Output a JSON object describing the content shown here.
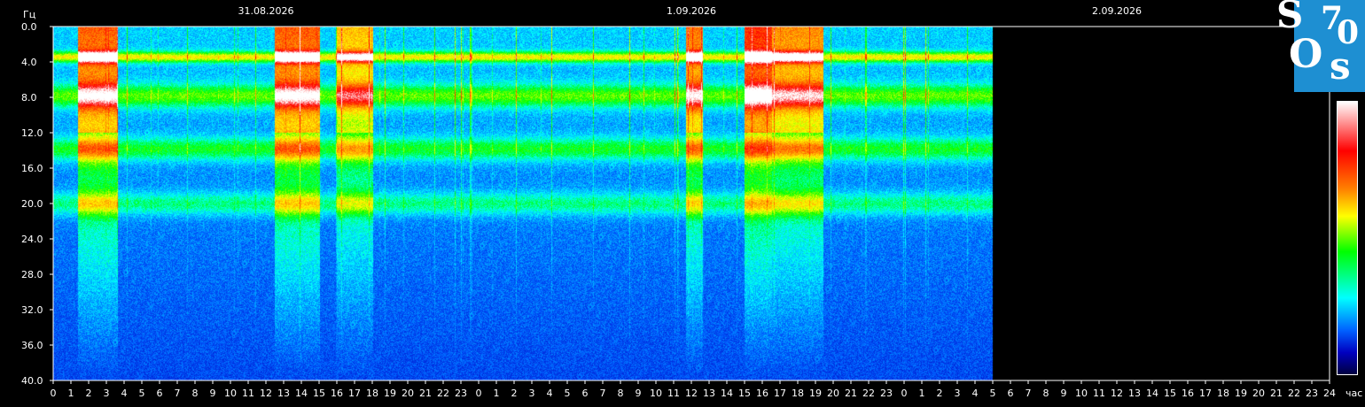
{
  "chart_data": {
    "type": "heatmap",
    "title": "",
    "ylabel": "Гц",
    "xlabel": "час",
    "ylim": [
      0,
      40
    ],
    "y_ticks": [
      "0.0",
      "4.0",
      "8.0",
      "12.0",
      "16.0",
      "20.0",
      "24.0",
      "28.0",
      "32.0",
      "36.0",
      "40.0"
    ],
    "x_ticks": [
      "0",
      "1",
      "2",
      "3",
      "4",
      "5",
      "6",
      "7",
      "8",
      "9",
      "10",
      "11",
      "12",
      "13",
      "14",
      "15",
      "16",
      "17",
      "18",
      "19",
      "20",
      "21",
      "22",
      "23",
      "0",
      "1",
      "2",
      "3",
      "4",
      "5",
      "6",
      "7",
      "8",
      "9",
      "10",
      "11",
      "12",
      "13",
      "14",
      "15",
      "16",
      "17",
      "18",
      "19",
      "20",
      "21",
      "22",
      "23",
      "0",
      "1",
      "2",
      "3",
      "4",
      "5",
      "6",
      "7",
      "8",
      "9",
      "10",
      "11",
      "12",
      "13",
      "14",
      "15",
      "16",
      "17",
      "18",
      "19",
      "20",
      "21",
      "22",
      "23",
      "24"
    ],
    "dates": [
      {
        "label": "31.08.2026",
        "hour": 12
      },
      {
        "label": "1.09.2026",
        "hour": 36
      },
      {
        "label": "2.09.2026",
        "hour": 60
      }
    ],
    "data_end_hour": 53,
    "x_range_hours": [
      0,
      72
    ],
    "resonance_bands_hz": [
      3.4,
      7.8,
      13.8,
      20.0
    ],
    "bursts": [
      {
        "start": 1.4,
        "end": 3.6,
        "level": 0.9
      },
      {
        "start": 12.5,
        "end": 15.0,
        "level": 0.9
      },
      {
        "start": 16.0,
        "end": 18.0,
        "level": 0.7
      },
      {
        "start": 35.7,
        "end": 36.6,
        "level": 0.85
      },
      {
        "start": 39.0,
        "end": 40.5,
        "level": 1.0
      },
      {
        "start": 40.5,
        "end": 43.4,
        "level": 0.8
      }
    ],
    "colorscale": [
      "#000040",
      "#0000c0",
      "#0060ff",
      "#00ffff",
      "#00ff00",
      "#ffff00",
      "#ff8000",
      "#ff0000",
      "#ffffff"
    ]
  },
  "logo": {
    "l1": "S",
    "l2": "7",
    "l3": "0",
    "l4": "O",
    "l5": "s"
  }
}
